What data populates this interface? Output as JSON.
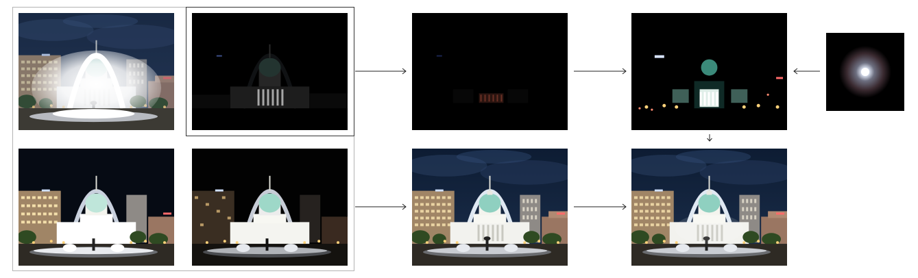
{
  "figure": {
    "panels": [
      {
        "name": "input-exposure-long"
      },
      {
        "name": "input-exposure-short-highlighted"
      },
      {
        "name": "input-exposure-medium"
      },
      {
        "name": "input-exposure-very-short"
      },
      {
        "name": "intermediate-highlight-image"
      },
      {
        "name": "glare-convolved-highlights"
      },
      {
        "name": "point-spread-function"
      },
      {
        "name": "hdr-merged-result"
      },
      {
        "name": "final-result-with-glare"
      }
    ],
    "arrows": [
      {
        "from": "inputs-top",
        "to": "intermediate-highlight-image"
      },
      {
        "from": "intermediate-highlight-image",
        "to": "glare-convolved-highlights"
      },
      {
        "from": "point-spread-function",
        "to": "glare-convolved-highlights"
      },
      {
        "from": "glare-convolved-highlights",
        "to": "final-result-with-glare"
      },
      {
        "from": "inputs-bottom",
        "to": "hdr-merged-result"
      },
      {
        "from": "hdr-merged-result",
        "to": "final-result-with-glare"
      }
    ],
    "colors": {
      "frame": "#b3b3b3",
      "highlight_frame": "#333333",
      "arrow": "#222222",
      "night_sky": "#0d1c33",
      "arch": "#dfe8f2",
      "dome": "#8fd0c0",
      "glow": "#ffffff"
    }
  }
}
